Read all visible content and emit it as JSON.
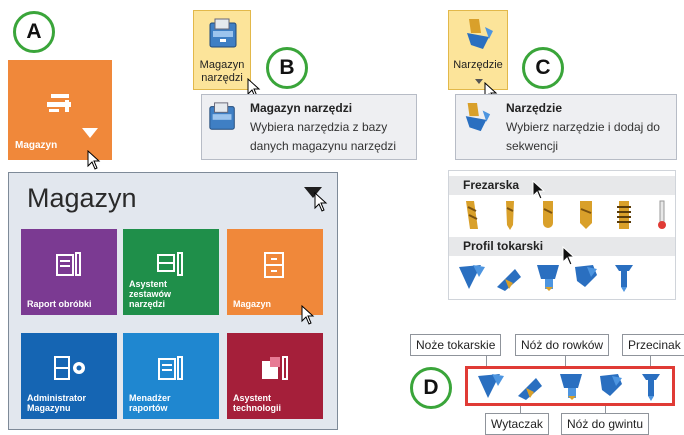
{
  "callouts": {
    "a": "A",
    "b": "B",
    "c": "C",
    "d": "D"
  },
  "panel_a": {
    "small_tile_label": "Magazyn",
    "panel_title": "Magazyn",
    "tiles": [
      {
        "label": "Raport obróbki",
        "color": "#7b3a92",
        "icon": "report-icon"
      },
      {
        "label": "Asystent\nzestawów\nnarzędzi",
        "color": "#1f8f4a",
        "icon": "assembly-assistant-icon"
      },
      {
        "label": "Magazyn",
        "color": "#f0883a",
        "icon": "cabinet-icon"
      },
      {
        "label": "Administrator\nMagazynu",
        "color": "#1565b3",
        "icon": "admin-gear-icon"
      },
      {
        "label": "Menadżer\nraportów",
        "color": "#1f87d0",
        "icon": "report-manager-icon"
      },
      {
        "label": "Asystent\ntechnologii",
        "color": "#a51f3a",
        "icon": "technology-assistant-icon"
      }
    ]
  },
  "panel_b": {
    "button_label": "Magazyn\nnarzędzi",
    "tooltip_title": "Magazyn narzędzi",
    "tooltip_desc_line1": "Wybiera narzędzia z bazy",
    "tooltip_desc_line2": "danych magazynu narzędzi"
  },
  "panel_c": {
    "button_label": "Narzędzie",
    "tooltip_title": "Narzędzie",
    "tooltip_desc_line1": "Wybierz narzędzie i dodaj do",
    "tooltip_desc_line2": "sekwencji",
    "group_milling": "Frezarska",
    "group_turning": "Profil tokarski"
  },
  "panel_d": {
    "labels_top": [
      "Noże tokarskie",
      "Nóż do rowków",
      "Przecinak"
    ],
    "labels_bottom": [
      "Wytaczak",
      "Nóż do gwintu"
    ]
  },
  "colors": {
    "accent_green": "#3aa53a",
    "highlight_red": "#e03b35",
    "ribbon_hover": "#fce49a"
  }
}
